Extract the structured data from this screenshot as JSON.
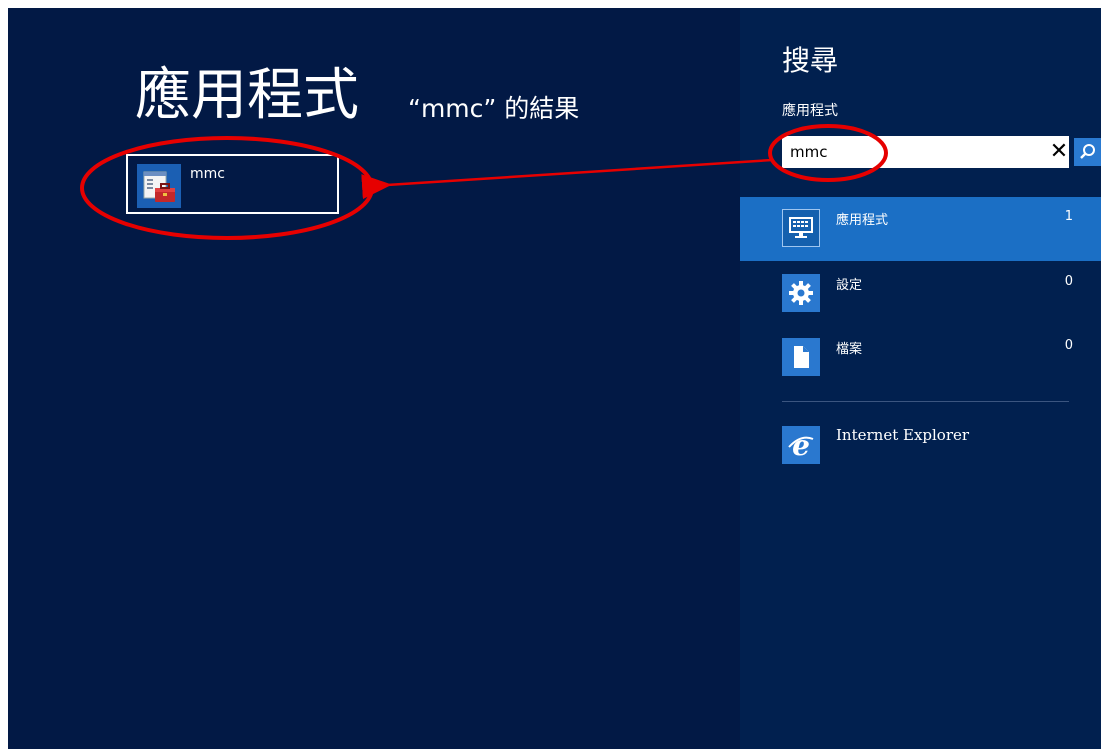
{
  "results": {
    "title": "應用程式",
    "query_label": "“mmc” 的結果",
    "items": [
      {
        "label": "mmc",
        "icon": "toolbox-console-icon"
      }
    ]
  },
  "charm": {
    "title": "搜尋",
    "scope": "應用程式",
    "search": {
      "value": "mmc",
      "clear_icon": "close-icon",
      "search_icon": "search-icon"
    },
    "categories": [
      {
        "label": "應用程式",
        "count": "1",
        "icon": "keyboard-monitor-icon",
        "selected": true
      },
      {
        "label": "設定",
        "count": "0",
        "icon": "gear-icon",
        "selected": false
      },
      {
        "label": "檔案",
        "count": "0",
        "icon": "document-icon",
        "selected": false
      }
    ],
    "apps": [
      {
        "label": "Internet Explorer",
        "icon": "internet-explorer-icon"
      }
    ]
  },
  "colors": {
    "background": "#021945",
    "charm_background": "#01204f",
    "selected_row": "#1b6fc5",
    "annotation": "#e60000"
  }
}
